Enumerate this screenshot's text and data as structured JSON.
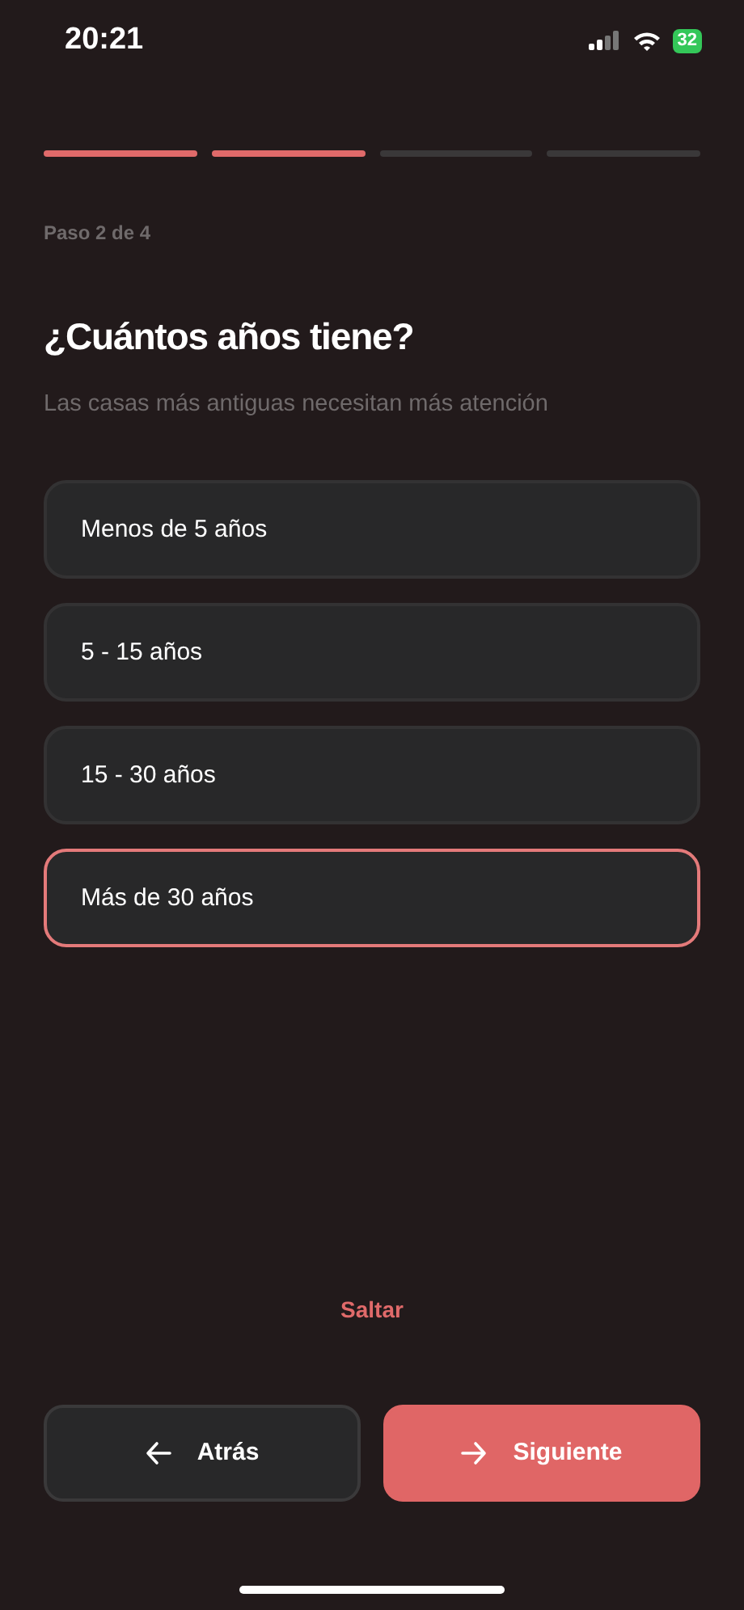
{
  "status_bar": {
    "time": "20:21",
    "battery": "32"
  },
  "progress": [
    {
      "done": true
    },
    {
      "done": true
    },
    {
      "done": false
    },
    {
      "done": false
    }
  ],
  "step_label": "Paso 2 de 4",
  "title": "¿Cuántos años tiene?",
  "subtitle": "Las casas más antiguas necesitan más atención",
  "options": [
    {
      "label": "Menos de 5 años",
      "selected": false
    },
    {
      "label": "5 - 15 años",
      "selected": false
    },
    {
      "label": "15 - 30 años",
      "selected": false
    },
    {
      "label": "Más de 30 años",
      "selected": true
    }
  ],
  "skip": "Saltar",
  "buttons": [
    {
      "kind": "back",
      "label": "Atrás"
    },
    {
      "kind": "next",
      "label": "Siguiente"
    }
  ]
}
